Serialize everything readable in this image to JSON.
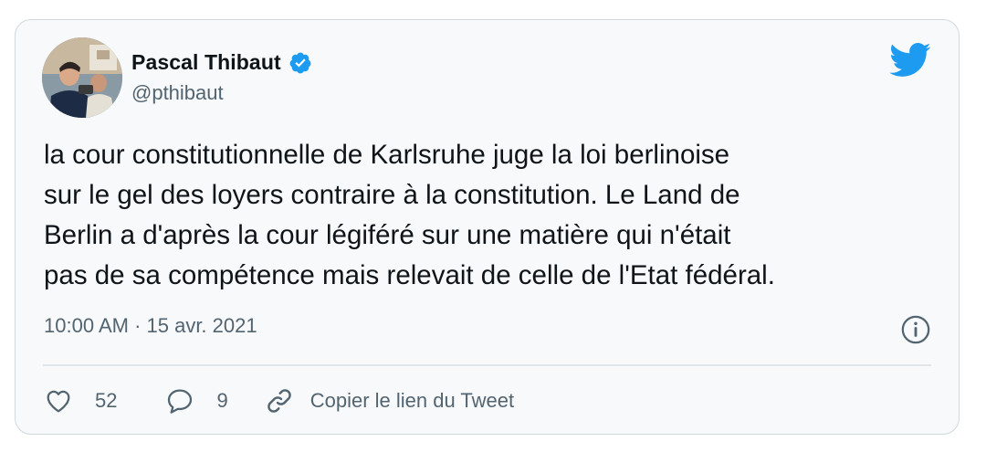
{
  "tweet": {
    "author": {
      "display_name": "Pascal Thibaut",
      "handle": "@pthibaut",
      "verified": true
    },
    "text": "la cour constitutionnelle de Karlsruhe juge la loi berlinoise\nsur le gel des loyers contraire à la constitution. Le Land de\nBerlin a d'après la cour légiféré sur une matière qui n'était\npas de sa compétence mais relevait de celle de l'Etat fédéral.",
    "timestamp": "10:00 AM · 15 avr. 2021",
    "actions": {
      "like_count": "52",
      "reply_count": "9",
      "copy_link_label": "Copier le lien du Tweet"
    }
  },
  "icons": {
    "brand": "twitter-bird-icon",
    "verified": "verified-badge-icon",
    "info": "info-icon",
    "like": "heart-icon",
    "reply": "speech-bubble-icon",
    "copy": "link-icon"
  },
  "colors": {
    "brand_blue": "#1d9bf0",
    "text_primary": "#0f1419",
    "text_secondary": "#536471",
    "card_background": "#f7f9fa",
    "card_border": "#cfd9de"
  }
}
